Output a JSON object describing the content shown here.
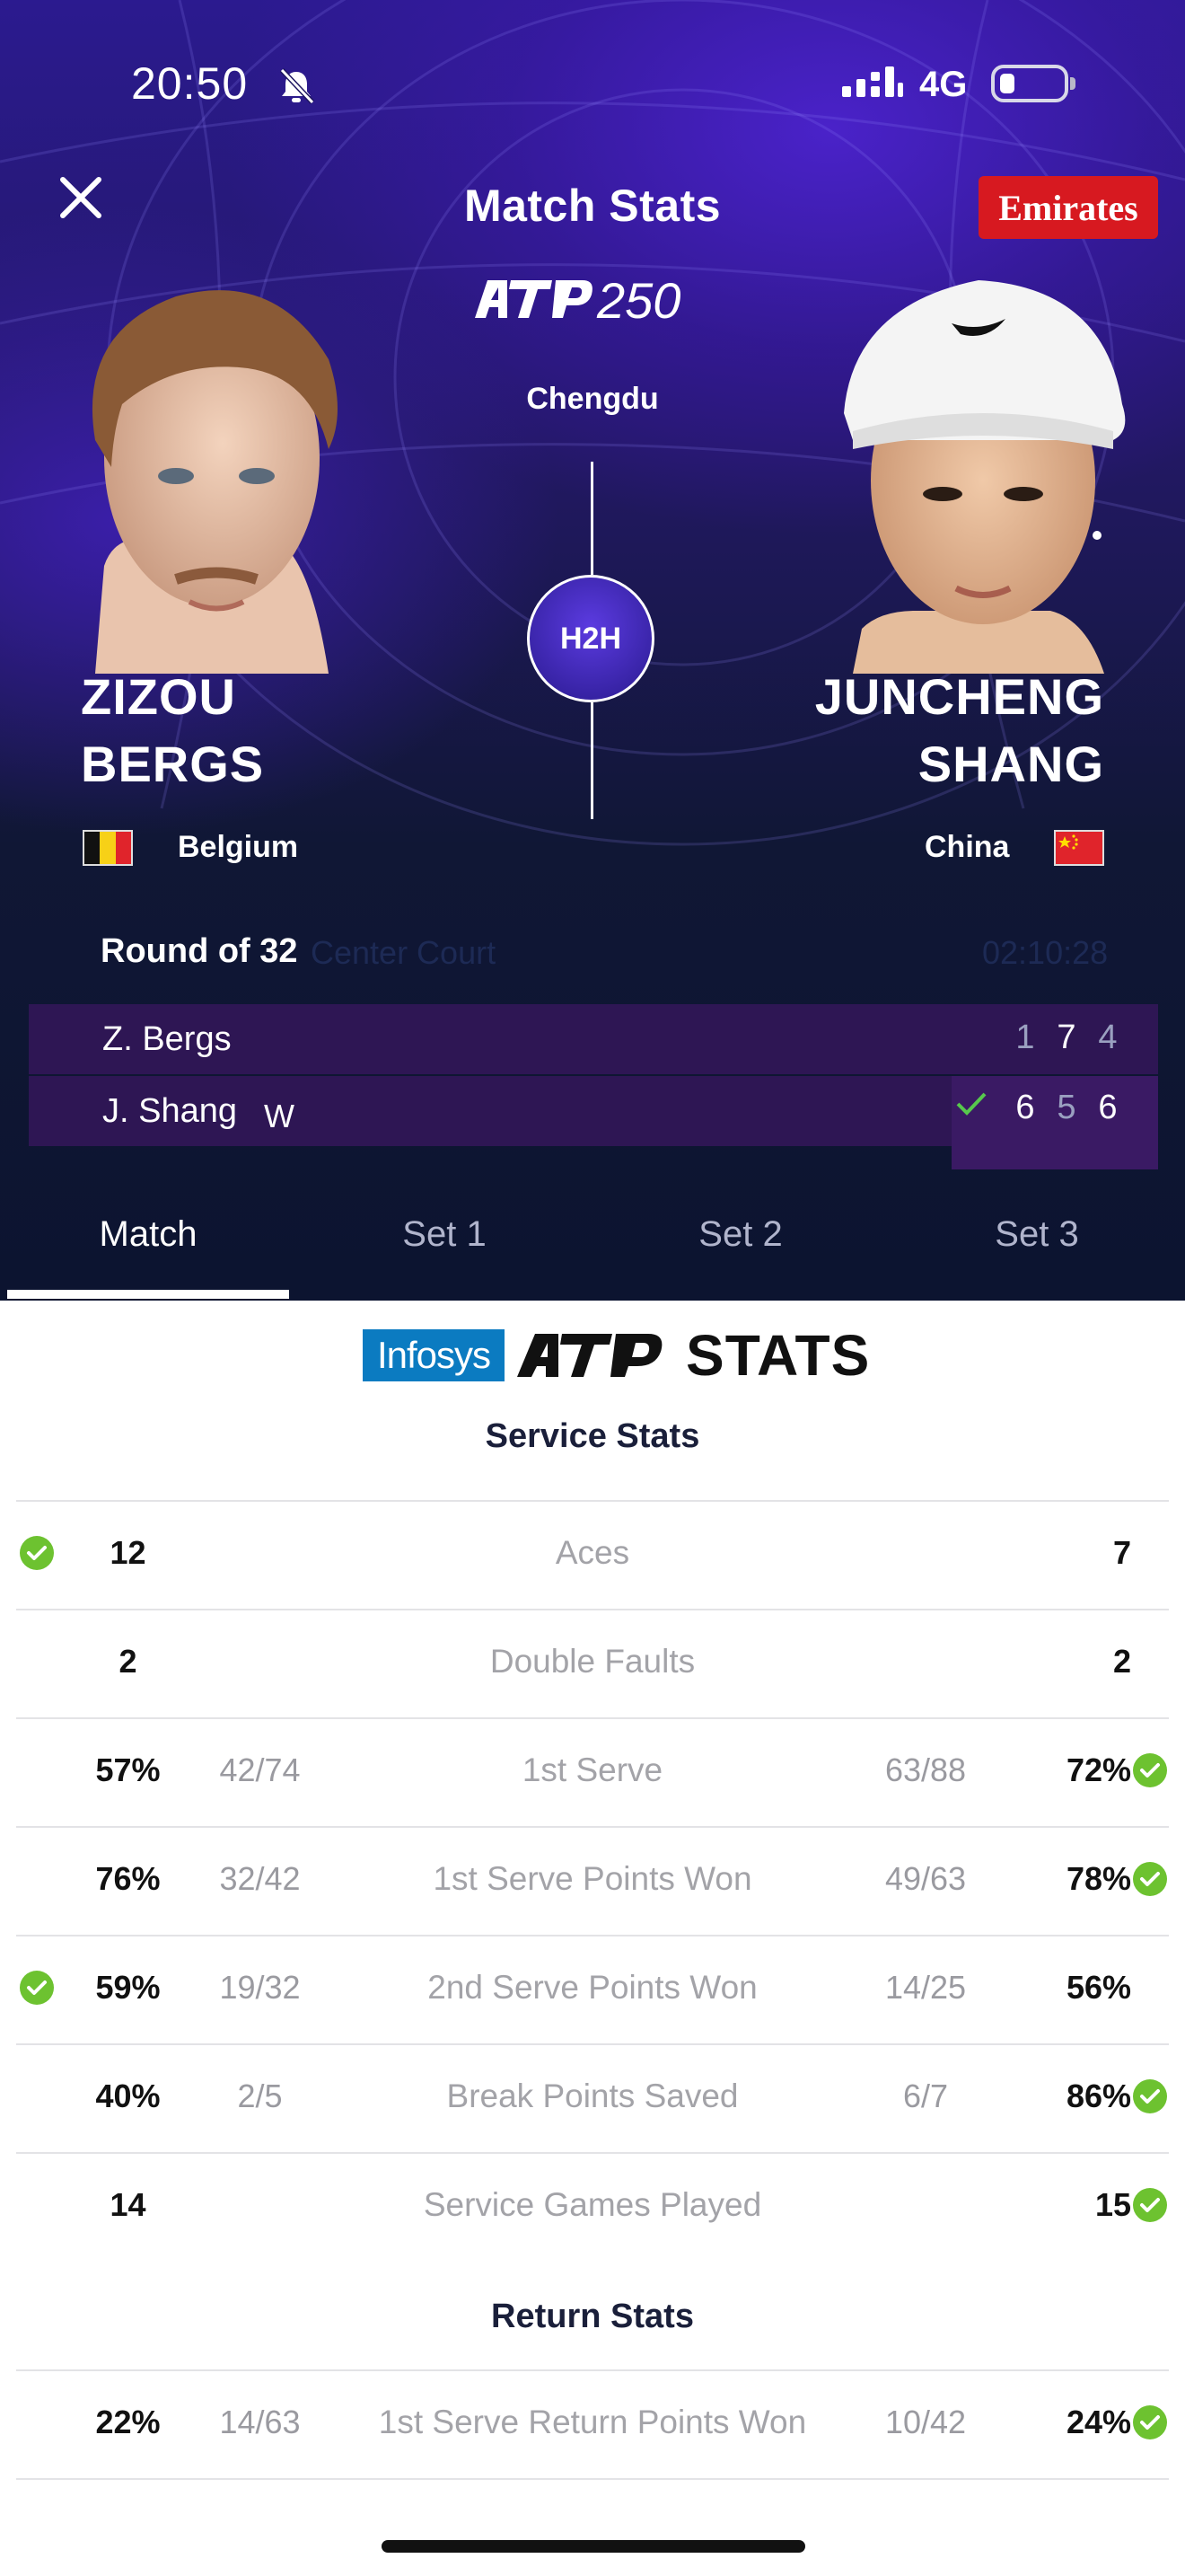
{
  "status_bar": {
    "time": "20:50",
    "network": "4G"
  },
  "header": {
    "title": "Match Stats",
    "sponsor": "Emirates",
    "tournament_logo": "ATP250",
    "city": "Chengdu",
    "h2h_label": "H2H"
  },
  "players": {
    "left": {
      "first": "ZIZOU",
      "last": "BERGS",
      "country": "Belgium"
    },
    "right": {
      "first": "JUNCHENG",
      "last": "SHANG",
      "country": "China"
    }
  },
  "match": {
    "round": "Round of 32",
    "court": "Center Court",
    "duration": "02:10:28",
    "scores": [
      {
        "name": "Z. Bergs",
        "winner_mark": "",
        "sets": [
          "1",
          "7",
          "4"
        ]
      },
      {
        "name": "J. Shang",
        "winner_mark": "W",
        "sets": [
          "6",
          "5",
          "6"
        ]
      }
    ]
  },
  "tabs": [
    "Match",
    "Set 1",
    "Set 2",
    "Set 3"
  ],
  "stats_header": {
    "brand": "Infosys",
    "title": "STATS"
  },
  "sections": {
    "service": "Service Stats",
    "return": "Return Stats"
  },
  "stats": [
    {
      "label": "Aces",
      "left_value": "12",
      "left_frac": "",
      "right_frac": "",
      "right_value": "7",
      "leader": "left"
    },
    {
      "label": "Double Faults",
      "left_value": "2",
      "left_frac": "",
      "right_frac": "",
      "right_value": "2",
      "leader": ""
    },
    {
      "label": "1st Serve",
      "left_value": "57%",
      "left_frac": "42/74",
      "right_frac": "63/88",
      "right_value": "72%",
      "leader": "right"
    },
    {
      "label": "1st Serve Points Won",
      "left_value": "76%",
      "left_frac": "32/42",
      "right_frac": "49/63",
      "right_value": "78%",
      "leader": "right"
    },
    {
      "label": "2nd Serve Points Won",
      "left_value": "59%",
      "left_frac": "19/32",
      "right_frac": "14/25",
      "right_value": "56%",
      "leader": "left"
    },
    {
      "label": "Break Points Saved",
      "left_value": "40%",
      "left_frac": "2/5",
      "right_frac": "6/7",
      "right_value": "86%",
      "leader": "right"
    },
    {
      "label": "Service Games Played",
      "left_value": "14",
      "left_frac": "",
      "right_frac": "",
      "right_value": "15",
      "leader": "right"
    },
    {
      "label": "1st Serve Return Points Won",
      "left_value": "22%",
      "left_frac": "14/63",
      "right_frac": "10/42",
      "right_value": "24%",
      "leader": "right"
    }
  ],
  "colors": {
    "accent_check": "#6dc230",
    "sponsor_red": "#d71920",
    "hero_top": "#2b1a8f",
    "hero_bottom": "#0c1430",
    "score_row": "#2e1654"
  }
}
